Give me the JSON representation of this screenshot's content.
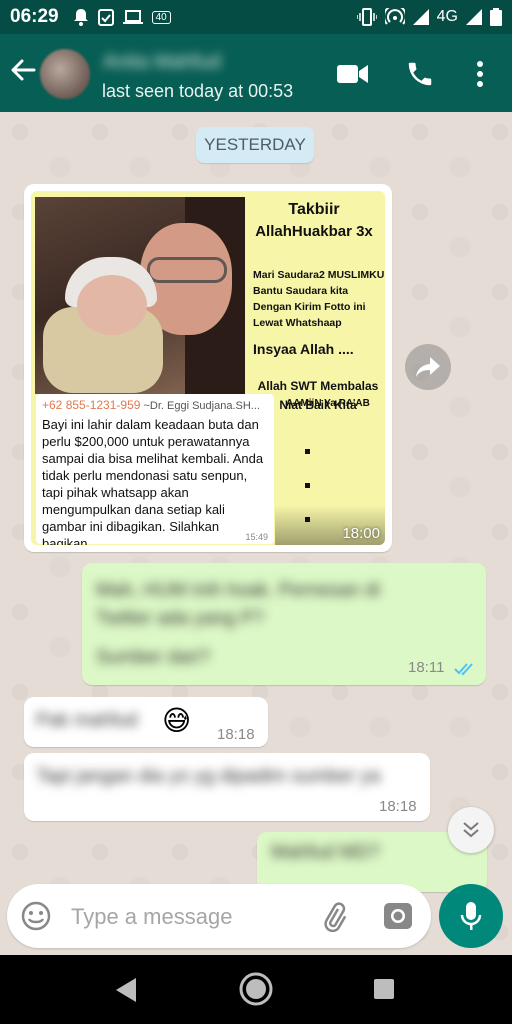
{
  "status_bar": {
    "time": "06:29",
    "badge": "40",
    "network": "4G"
  },
  "header": {
    "contact_name": "Anita Mahfud",
    "last_seen": "last seen today at 00:53"
  },
  "chat": {
    "date_label": "YESTERDAY",
    "image_message": {
      "poster": {
        "title_line1": "Takbiir",
        "title_line2": "AllahHuakbar 3x",
        "subtitle": "Mari Saudara2 MUSLIMKU Bantu Saudara kita Dengan Kirim Fotto ini Lewat Whatshaap",
        "insya": "Insyaa Allah ....",
        "allah_line": "Allah SWT Membalas Niat Baik Kita",
        "aamiin": "AAMiiN Ya RA'AB"
      },
      "quote_sender_number": "+62 855-1231-959",
      "quote_sender_name": "~Dr. Eggi Sudjana.SH...",
      "quote_text": "Bayi ini lahir dalam keadaan buta dan perlu $200,000 untuk perawatannya sampai dia bisa melihat kembali. Anda tidak perlu mendonasi satu senpun, tapi pihak whatsapp akan mengumpulkan dana setiap kali gambar ini dibagikan. Silahkan bagikan",
      "quote_time": "15:49",
      "time": "18:00"
    },
    "messages": [
      {
        "direction": "out",
        "text": "Mah, HUM inih hoak. Pernesan di Twitter ada yang P?",
        "text2": "Sumber dari?",
        "time": "18:11",
        "status": "read"
      },
      {
        "direction": "in",
        "text": "Pak mahfud",
        "emoji": "😅",
        "time": "18:18"
      },
      {
        "direction": "in",
        "text": "Tapi jangan dia yo yg dipadim sumber ya",
        "time": "18:18"
      },
      {
        "direction": "out",
        "text": "Mahfud MD?"
      }
    ]
  },
  "composer": {
    "placeholder": "Type a message"
  },
  "colors": {
    "header": "#075e54",
    "status_bar": "#054d44",
    "outgoing_bubble": "#dcf8c6",
    "incoming_bubble": "#ffffff",
    "accent": "#00897b",
    "read_ticks": "#4fc3f7"
  }
}
